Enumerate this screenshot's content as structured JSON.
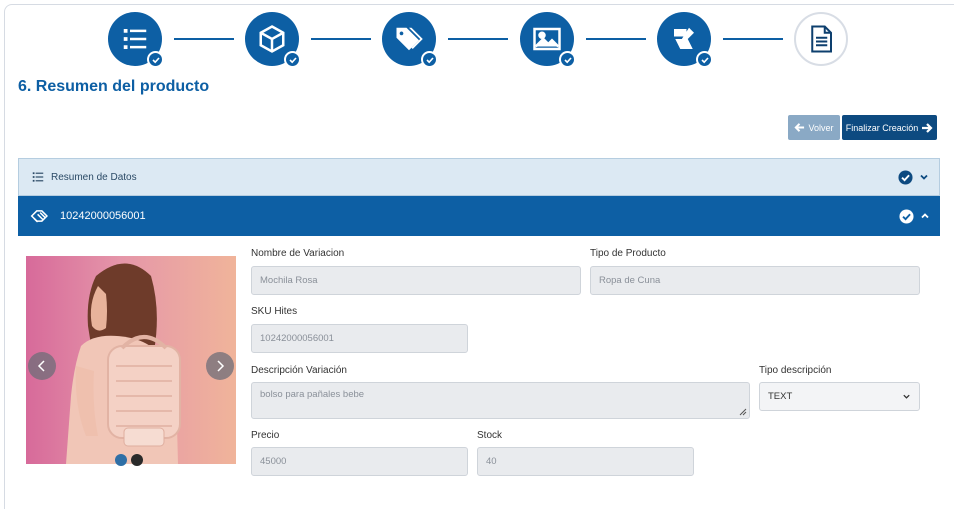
{
  "stepper": {
    "steps": [
      {
        "icon": "list-icon",
        "status": "completed"
      },
      {
        "icon": "box-icon",
        "status": "completed"
      },
      {
        "icon": "tags-icon",
        "status": "completed"
      },
      {
        "icon": "image-icon",
        "status": "completed"
      },
      {
        "icon": "tools-icon",
        "status": "completed"
      },
      {
        "icon": "document-icon",
        "status": "current"
      }
    ]
  },
  "page": {
    "title": "6. Resumen del producto"
  },
  "actions": {
    "back_label": "Volver",
    "finish_label": "Finalizar Creación"
  },
  "accordion": {
    "summary_label": "Resumen de Datos",
    "variant_label": "10242000056001"
  },
  "carousel": {
    "images": 2,
    "active_index": 0
  },
  "form": {
    "variation_name_label": "Nombre de Variacion",
    "variation_name_value": "Mochila Rosa",
    "product_type_label": "Tipo de Producto",
    "product_type_value": "Ropa de Cuna",
    "sku_label": "SKU Hites",
    "sku_value": "10242000056001",
    "description_label": "Descripción Variación",
    "description_value": "bolso para pañales bebe",
    "description_type_label": "Tipo descripción",
    "description_type_value": "TEXT",
    "price_label": "Precio",
    "price_value": "45000",
    "stock_label": "Stock",
    "stock_value": "40"
  },
  "colors": {
    "primary": "#0d5fa4",
    "dark_button": "#0d4a80",
    "light_button": "#8aa9c5",
    "accordion_light": "#dce9f3"
  }
}
